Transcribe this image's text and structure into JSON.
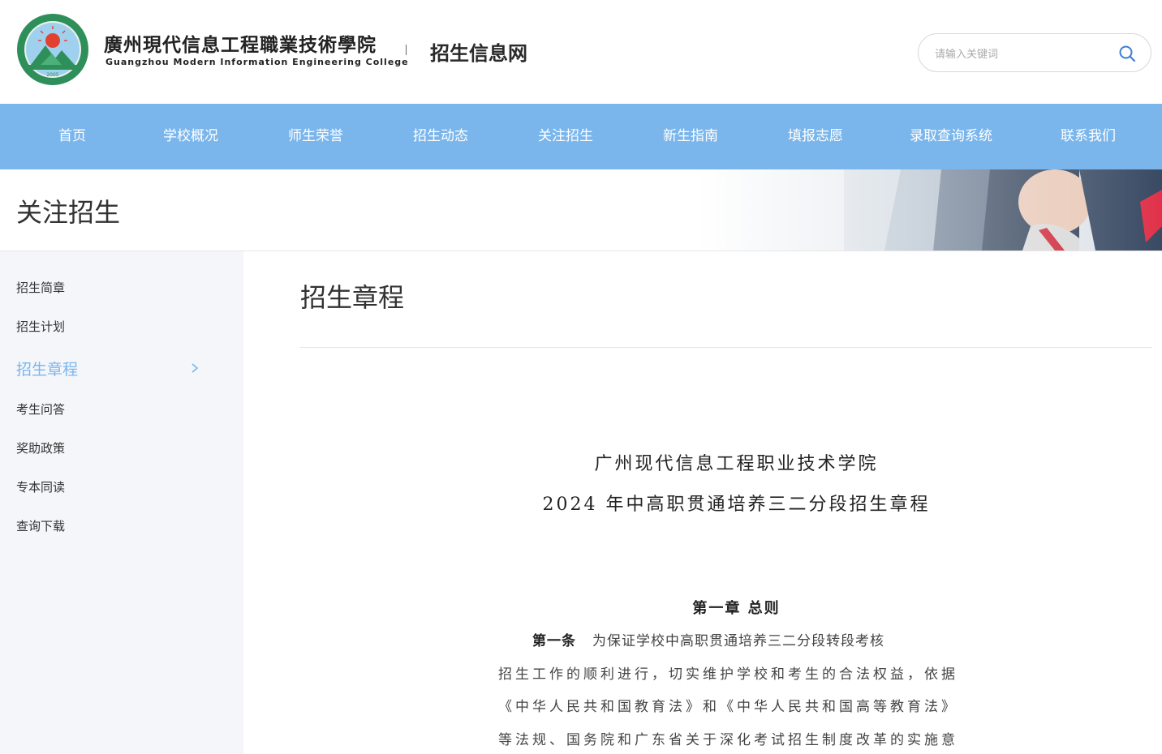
{
  "header": {
    "college_name_cn": "廣州現代信息工程職業技術學院",
    "college_name_en": "Guangzhou Modern Information Engineering College",
    "site_name": "招生信息网",
    "search_placeholder": "请输入关键词"
  },
  "nav": {
    "items": [
      "首页",
      "学校概况",
      "师生荣誉",
      "招生动态",
      "关注招生",
      "新生指南",
      "填报志愿",
      "录取查询系统",
      "联系我们"
    ]
  },
  "banner": {
    "title": "关注招生"
  },
  "sidebar": {
    "items": [
      "招生简章",
      "招生计划",
      "招生章程",
      "考生问答",
      "奖助政策",
      "专本同读",
      "查询下载"
    ],
    "active_index": 2
  },
  "content": {
    "title": "招生章程",
    "doc_title_line1": "广州现代信息工程职业技术学院",
    "doc_title_line2": "2024 年中高职贯通培养三二分段招生章程",
    "chapter_heading": "第一章  总则",
    "article_label": "第一条",
    "lines": [
      "为保证学校中高职贯通培养三二分段转段考核",
      "招生工作的顺利进行，切实维护学校和考生的合法权益，依据",
      "《中华人民共和国教育法》和《中华人民共和国高等教育法》",
      "等法规、国务院和广东省关于深化考试招生制度改革的实施意"
    ]
  },
  "colors": {
    "nav_bg": "#7ab6ec",
    "active": "#7ab6ec",
    "sidebar_bg": "#f4f6fa"
  }
}
